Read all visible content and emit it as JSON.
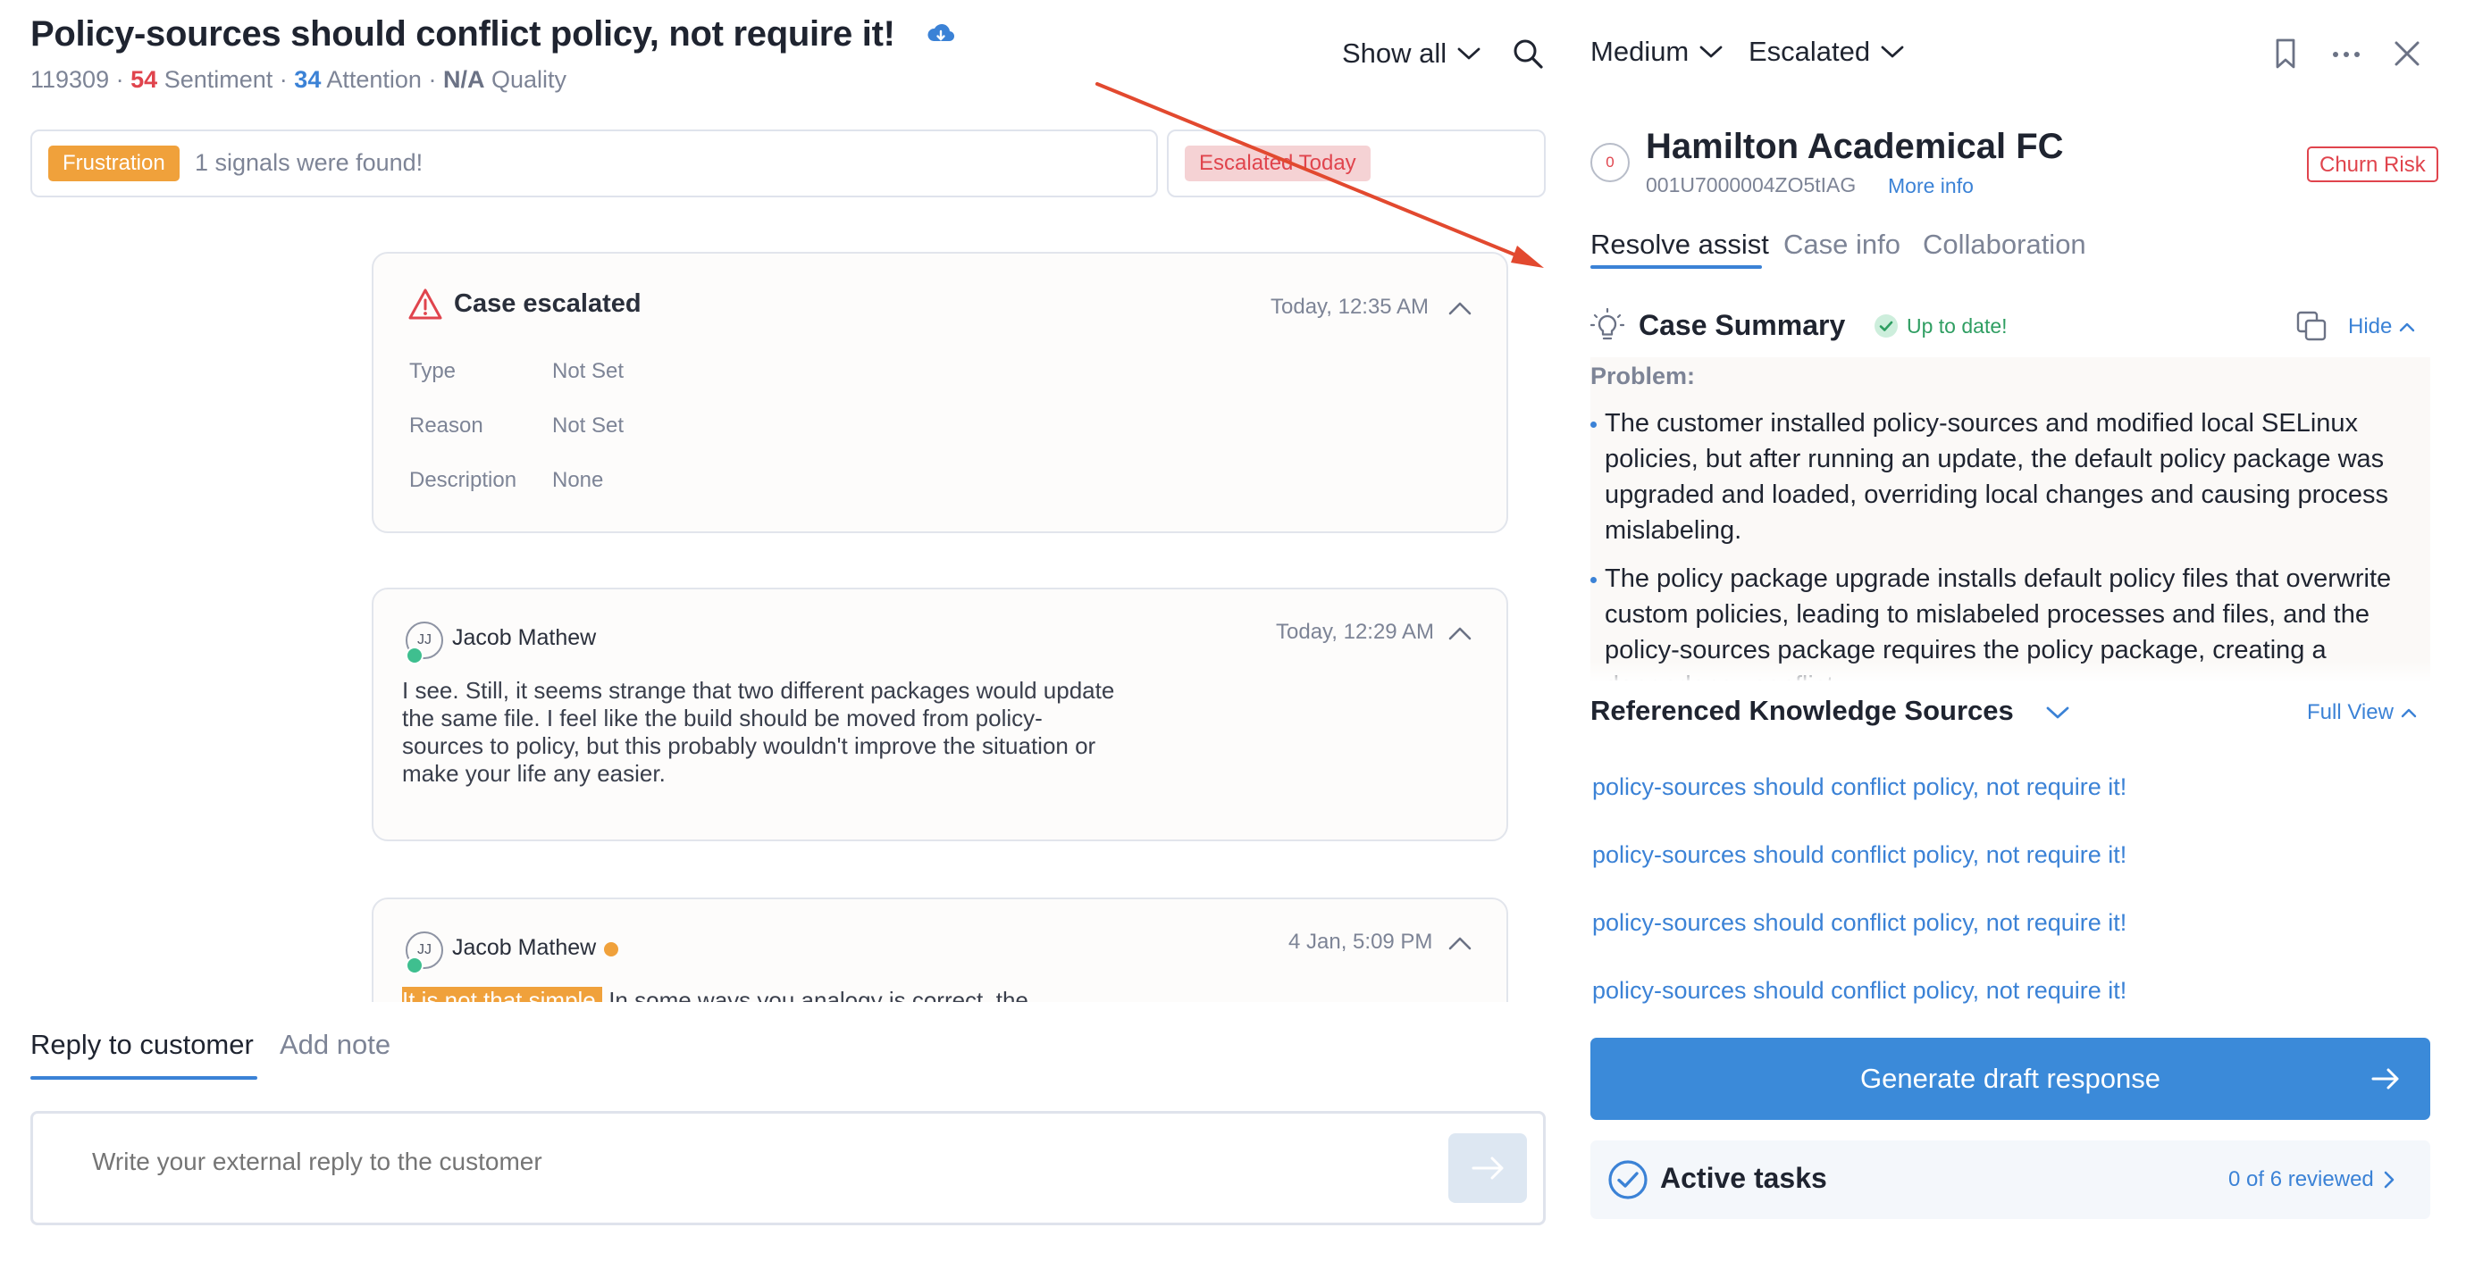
{
  "header": {
    "title": "Policy-sources should conflict policy, not require it!",
    "case_number": "119309",
    "sentiment_value": "54",
    "sentiment_label": "Sentiment",
    "attention_value": "34",
    "attention_label": "Attention",
    "quality_value": "N/A",
    "quality_label": "Quality",
    "separator": "·",
    "show_all_label": "Show all"
  },
  "signals": {
    "badge": "Frustration",
    "text": "1 signals were found!",
    "escalation_badge": "Escalated Today"
  },
  "timeline": {
    "escalation": {
      "title": "Case escalated",
      "time": "Today, 12:35 AM",
      "fields": [
        {
          "label": "Type",
          "value": "Not Set"
        },
        {
          "label": "Reason",
          "value": "Not Set"
        },
        {
          "label": "Description",
          "value": "None"
        }
      ]
    },
    "messages": [
      {
        "initials": "JJ",
        "author": "Jacob Mathew",
        "time": "Today, 12:29 AM",
        "body": "I see. Still, it seems strange that two different packages would update the same file. I feel like the build should be moved from policy-sources to policy, but this probably wouldn't improve the situation or make your life any easier."
      },
      {
        "initials": "JJ",
        "author": "Jacob Mathew",
        "time": "4 Jan, 5:09 PM",
        "highlight": "It is not that simple.",
        "body": " In some ways you analogy is correct, the"
      }
    ]
  },
  "reply": {
    "tab_reply": "Reply to customer",
    "tab_note": "Add note",
    "placeholder": "Write your external reply to the customer"
  },
  "right": {
    "priority": "Medium",
    "status": "Escalated",
    "account": {
      "score": "0",
      "name": "Hamilton Academical FC",
      "id": "001U7000004ZO5tIAG",
      "more_info": "More info",
      "churn_badge": "Churn Risk"
    },
    "tabs": [
      "Resolve assist",
      "Case info",
      "Collaboration"
    ],
    "summary": {
      "title": "Case Summary",
      "status": "Up to date!",
      "hide_label": "Hide",
      "problem_label": "Problem:",
      "bullets": [
        "The customer installed policy-sources and modified local SELinux policies, but after running an update, the default policy package was upgraded and loaded, overriding local changes and causing process mislabeling.",
        "The policy package upgrade installs default policy files that overwrite custom policies, leading to mislabeled processes and files, and the policy-sources package requires the policy package, creating a dependency conflict."
      ]
    },
    "knowledge": {
      "title": "Referenced Knowledge Sources",
      "full_view": "Full View",
      "sources": [
        "policy-sources should conflict policy, not require it!",
        "policy-sources should conflict policy, not require it!",
        "policy-sources should conflict policy, not require it!",
        "policy-sources should conflict policy, not require it!"
      ]
    },
    "generate_label": "Generate draft response",
    "tasks": {
      "title": "Active tasks",
      "count": "0 of 6 reviewed"
    }
  },
  "colors": {
    "accent": "#3b82d6",
    "danger": "#e0444d",
    "warning": "#f0a13b",
    "success": "#2f9e62",
    "annotation_arrow": "#e2492f"
  },
  "icons": [
    "cloud-sync-icon",
    "search-icon",
    "chevron-down-icon",
    "warning-icon",
    "chevron-up-icon",
    "bookmark-icon",
    "more-icon",
    "close-icon",
    "lightbulb-icon",
    "check-circle-icon",
    "copy-icon",
    "arrow-right-icon",
    "chevron-right-icon"
  ]
}
